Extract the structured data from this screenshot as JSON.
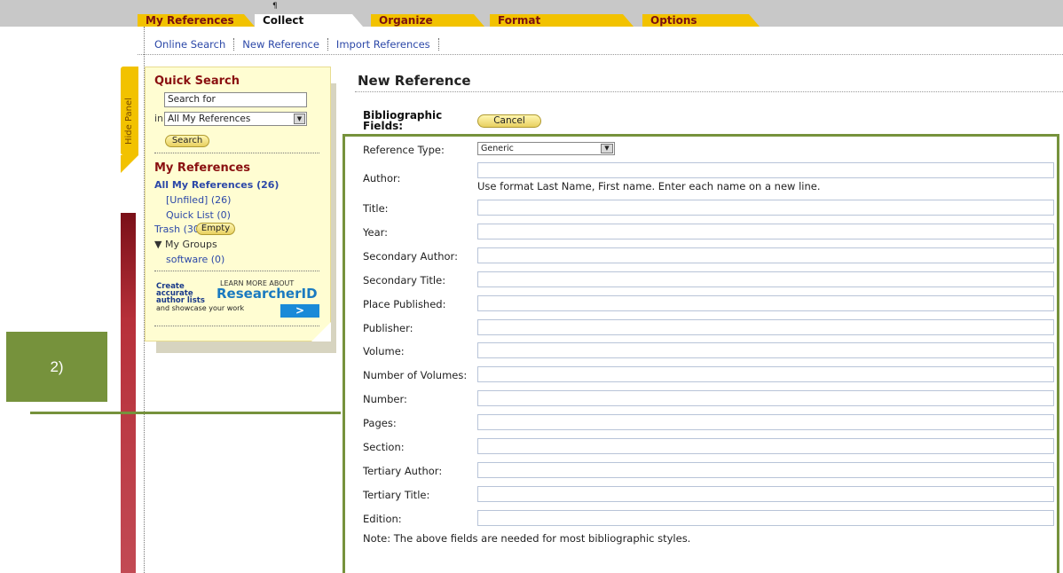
{
  "tabs": [
    {
      "label": "My References",
      "active": false
    },
    {
      "label": "Collect",
      "active": true
    },
    {
      "label": "Organize",
      "active": false
    },
    {
      "label": "Format",
      "active": false
    },
    {
      "label": "Options",
      "active": false
    }
  ],
  "tab_marker": "¶",
  "subnav": {
    "online_search": "Online Search",
    "new_reference": "New Reference",
    "import_references": "Import References"
  },
  "hide_panel": "Hide Panel",
  "quick_search": {
    "title": "Quick Search",
    "search_for": "Search for",
    "in_label": "in",
    "scope": "All My References",
    "button": "Search"
  },
  "my_references": {
    "title": "My References",
    "all": "All My References (26)",
    "unfiled": "[Unfiled] (26)",
    "quick_list": "Quick List (0)",
    "trash": "Trash (30)",
    "empty_button": "Empty",
    "my_groups": "▼ My Groups",
    "group_software": "software (0)"
  },
  "researcherid": {
    "create": "Create",
    "accurate": "accurate",
    "author_lists": "author lists",
    "showcase": "and showcase your work",
    "learn": "LEARN MORE ABOUT",
    "logo": "ResearcherID",
    "go": ">"
  },
  "annotation": {
    "label": "2)"
  },
  "main": {
    "title": "New Reference",
    "bib_label": "Bibliographic Fields:",
    "cancel": "Cancel",
    "reference_type_label": "Reference Type:",
    "reference_type_value": "Generic",
    "author_label": "Author:",
    "author_hint": "Use format Last Name, First name. Enter each name on a new line.",
    "fields": [
      "Title:",
      "Year:",
      "Secondary Author:",
      "Secondary Title:",
      "Place Published:",
      "Publisher:",
      "Volume:",
      "Number of Volumes:",
      "Number:",
      "Pages:",
      "Section:",
      "Tertiary Author:",
      "Tertiary Title:",
      "Edition:"
    ],
    "note": "Note: The above fields are needed for most bibliographic styles."
  },
  "colors": {
    "tab_yellow": "#f2c200",
    "panel_bg": "#fffdd2",
    "heading_red": "#8a1010",
    "link_blue": "#2c48a8",
    "annotation_green": "#76923c"
  }
}
